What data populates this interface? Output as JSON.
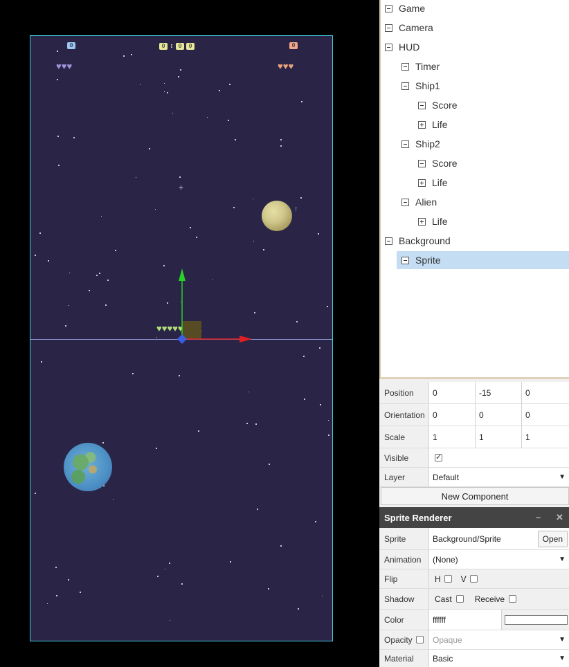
{
  "hud": {
    "p1_score": "0",
    "p2_score": "0",
    "timer": {
      "d1": "0",
      "d2": "0",
      "d3": "0"
    },
    "p1_hearts": "♥♥♥",
    "p2_hearts": "♥♥♥",
    "alien_hearts": "♥♥♥♥♥"
  },
  "hierarchy": {
    "game": "Game",
    "camera": "Camera",
    "hud": "HUD",
    "timer": "Timer",
    "ship1": "Ship1",
    "ship1_score": "Score",
    "ship1_life": "Life",
    "ship2": "Ship2",
    "ship2_score": "Score",
    "ship2_life": "Life",
    "alien": "Alien",
    "alien_life": "Life",
    "background": "Background",
    "sprite": "Sprite"
  },
  "inspector": {
    "position": {
      "label": "Position",
      "x": "0",
      "y": "-15",
      "z": "0"
    },
    "orientation": {
      "label": "Orientation",
      "x": "0",
      "y": "0",
      "z": "0"
    },
    "scale": {
      "label": "Scale",
      "x": "1",
      "y": "1",
      "z": "1"
    },
    "visible": {
      "label": "Visible",
      "checked": true
    },
    "layer": {
      "label": "Layer",
      "value": "Default"
    },
    "new_component": "New Component",
    "sprite_renderer": {
      "title": "Sprite Renderer",
      "minimize": "–",
      "close": "✕",
      "sprite_label": "Sprite",
      "sprite_value": "Background/Sprite",
      "open": "Open",
      "animation_label": "Animation",
      "animation_value": "(None)",
      "flip_label": "Flip",
      "flip_h": "H",
      "flip_v": "V",
      "shadow_label": "Shadow",
      "cast": "Cast",
      "receive": "Receive",
      "color_label": "Color",
      "color_value": "ffffff",
      "opacity_label": "Opacity",
      "opacity_value": "Opaque",
      "material_label": "Material",
      "material_value": "Basic"
    }
  },
  "colors": {
    "scene_bg": "#2a2446",
    "scene_border": "#3fd0dc",
    "axis_x": "#e02020",
    "axis_y": "#2ad02a",
    "selection": "#c4ddf3"
  }
}
